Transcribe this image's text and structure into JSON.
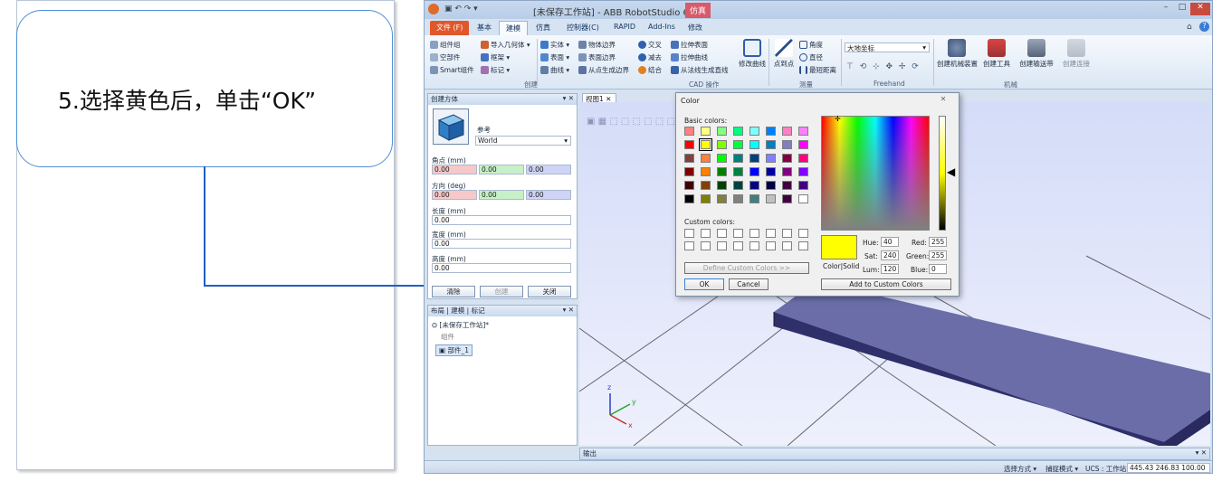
{
  "callout": {
    "text": "5.选择黄色后，单击“OK”"
  },
  "app": {
    "title": "[未保存工作站] - ABB RobotStudio 6...",
    "title_badge": "仿真",
    "window_controls": [
      "–",
      "□",
      "✕"
    ],
    "tabs": [
      "文件 (F)",
      "基本",
      "建模",
      "仿真",
      "控制器(C)",
      "RAPID",
      "Add-Ins",
      "修改"
    ],
    "ribbon": {
      "create": {
        "label": "创建",
        "items": [
          "组件组",
          "空部件",
          "Smart组件",
          "导入几何体 ▾",
          "框架 ▾",
          "标记 ▾"
        ]
      },
      "cad": {
        "label": "CAD 操作",
        "items": [
          "实体 ▾",
          "表面 ▾",
          "曲线 ▾",
          "物体边界",
          "表面边界",
          "从点生成边界",
          "交叉",
          "减去",
          "结合",
          "拉伸表面",
          "拉伸曲线",
          "从法线生成直线"
        ],
        "big": "修改曲线"
      },
      "measure": {
        "label": "测量",
        "big": "点到点",
        "items": [
          "角度",
          "直径",
          "最短距离"
        ]
      },
      "freehand": {
        "label": "Freehand",
        "dropdown": "大地坐标"
      },
      "mechanism": {
        "label": "机械",
        "items": [
          "创建机械装置",
          "创建工具",
          "创建输送带",
          "创建连接"
        ]
      }
    },
    "create_box_panel": {
      "title": "创建方体",
      "ref_label": "参考",
      "ref_value": "World",
      "corner_label": "角点 (mm)",
      "corner": [
        "0.00",
        "0.00",
        "0.00"
      ],
      "orient_label": "方向 (deg)",
      "orient": [
        "0.00",
        "0.00",
        "0.00"
      ],
      "length_label": "长度 (mm)",
      "length": "0.00",
      "width_label": "宽度 (mm)",
      "width": "0.00",
      "height_label": "高度 (mm)",
      "height": "0.00",
      "buttons": [
        "清除",
        "创建",
        "关闭"
      ]
    },
    "layout_panel": {
      "tabs": [
        "布局",
        "建模",
        "标记"
      ],
      "station": "[未保存工作站]*",
      "group": "组件",
      "part": "部件_1"
    },
    "viewport_tab": "视图1",
    "output_tab": "输出",
    "status": {
      "select_mode": "选择方式 ▾",
      "snap_mode": "捕捉模式 ▾",
      "ucs": "UCS : 工作站",
      "coords": "445.43  246.83  100.00"
    }
  },
  "color_dialog": {
    "title": "Color",
    "close": "✕",
    "basic_label": "Basic colors:",
    "custom_label": "Custom colors:",
    "define_btn": "Define Custom Colors >>",
    "ok": "OK",
    "cancel": "Cancel",
    "add_btn": "Add to Custom Colors",
    "colorsolid_label": "Color|Solid",
    "hue_label": "Hue:",
    "hue": "40",
    "sat_label": "Sat:",
    "sat": "240",
    "lum_label": "Lum:",
    "lum": "120",
    "red_label": "Red:",
    "red": "255",
    "green_label": "Green:",
    "green": "255",
    "blue_label": "Blue:",
    "blue": "0",
    "selected_color": "#ffff00",
    "basic_colors": [
      [
        "#ff8080",
        "#ffff80",
        "#80ff80",
        "#00ff80",
        "#80ffff",
        "#0080ff",
        "#ff80c0",
        "#ff80ff"
      ],
      [
        "#ff0000",
        "#ffff00",
        "#80ff00",
        "#00ff40",
        "#00ffff",
        "#0080c0",
        "#8080c0",
        "#ff00ff"
      ],
      [
        "#804040",
        "#ff8040",
        "#00ff00",
        "#008080",
        "#004080",
        "#8080ff",
        "#800040",
        "#ff0080"
      ],
      [
        "#800000",
        "#ff8000",
        "#008000",
        "#008040",
        "#0000ff",
        "#0000a0",
        "#800080",
        "#8000ff"
      ],
      [
        "#400000",
        "#804000",
        "#004000",
        "#004040",
        "#000080",
        "#000040",
        "#400040",
        "#400080"
      ],
      [
        "#000000",
        "#808000",
        "#808040",
        "#808080",
        "#408080",
        "#c0c0c0",
        "#400040",
        "#ffffff"
      ]
    ]
  }
}
